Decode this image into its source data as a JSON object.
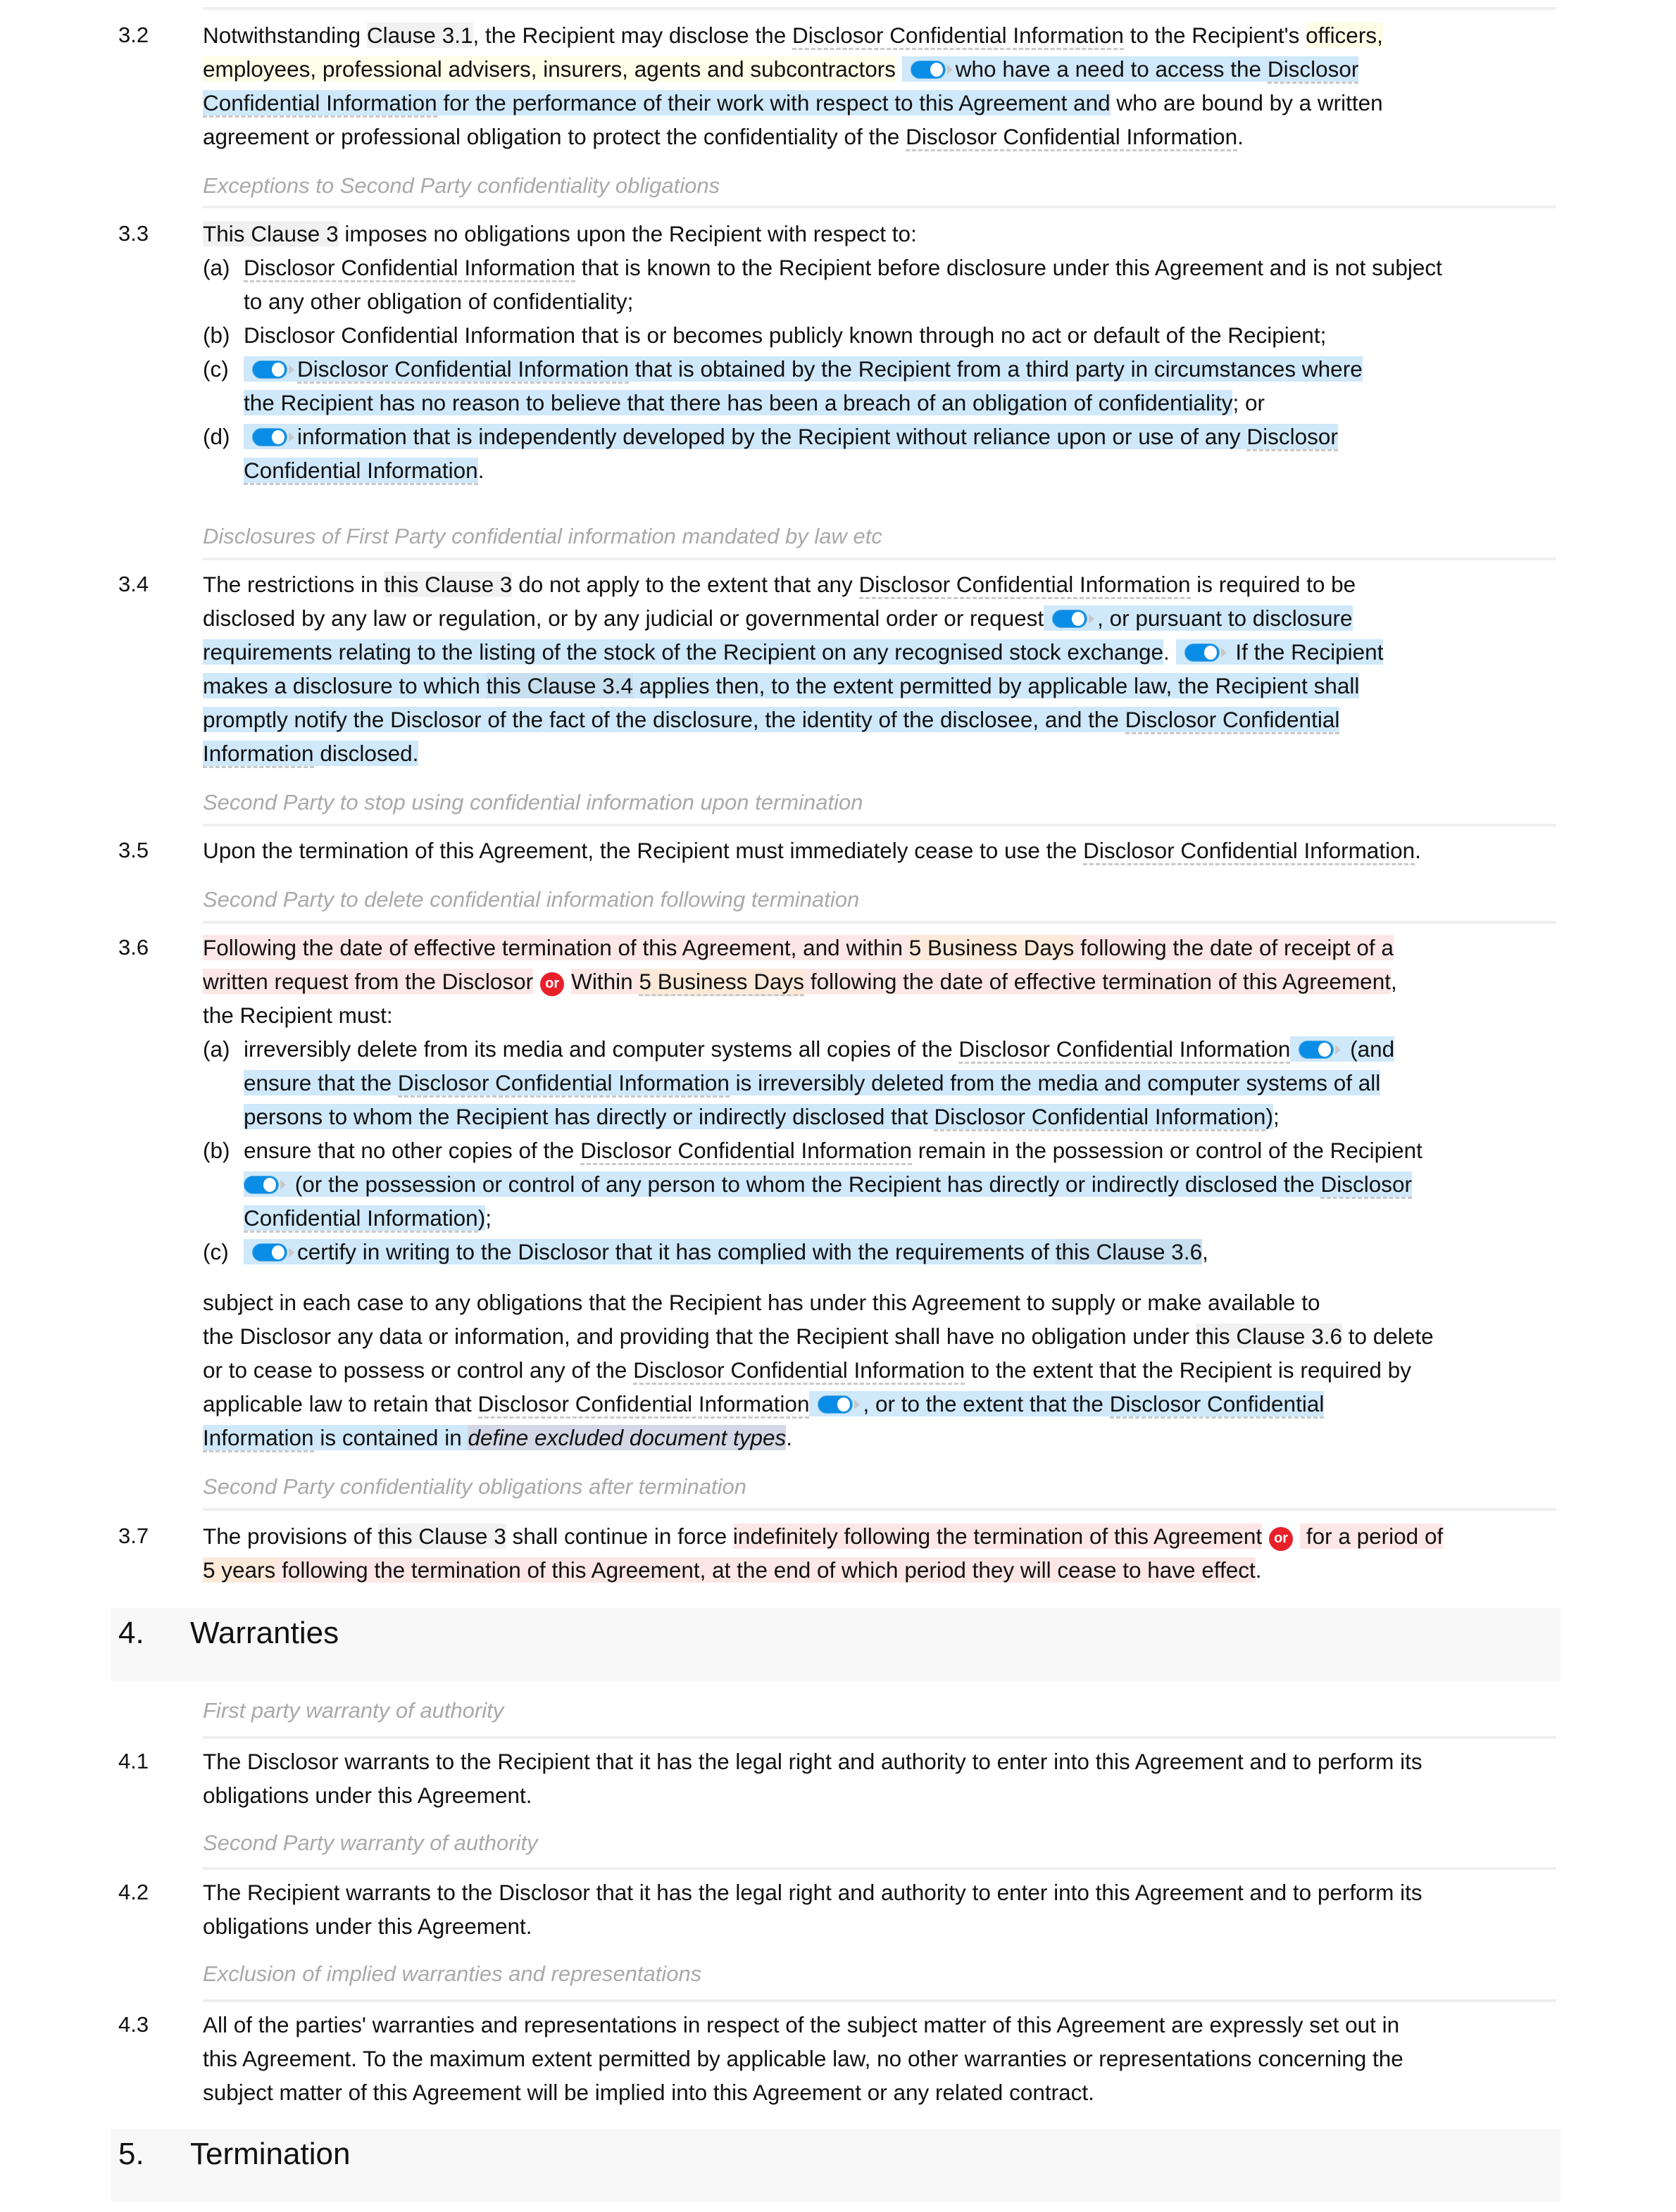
{
  "colors": {
    "toggle_on": "#0a8de6",
    "or_badge": "#e8202a",
    "optional_highlight": "#cfe8fa",
    "alternative_highlight": "#fde6e6",
    "variable_highlight": "#fde9d8",
    "editable_highlight": "#fefee8",
    "caption_text": "#a9a9a9"
  },
  "icons": {
    "toggle": "toggle-switch-on-icon",
    "or": "or-badge-icon"
  },
  "or_label": "or",
  "clause_3_2": {
    "number": "3.2",
    "l1a": "Notwithstanding ",
    "ref_3_1": "Clause 3.1",
    "l1b": ", the Recipient may disclose the ",
    "dci": "Disclosor Confidential Information",
    "l1c": " to the Recipient's ",
    "officers": "officers,",
    "l2a": "employees, professional advisers, insurers, agents and subcontractors",
    "l2b": "who have a need to access the ",
    "l2c": "Disclosor",
    "l3a": "Confidential Information",
    "l3b": " for the performance of their work with respect to this Agreement and",
    "l3c": " who are bound by a written",
    "l4a": "agreement or professional obligation to protect the confidentiality of the ",
    "l4b": "Disclosor Confidential Information",
    "l4c": "."
  },
  "caption_3_3": "Exceptions to Second Party confidentiality obligations",
  "clause_3_3": {
    "number": "3.3",
    "ref": "This Clause 3",
    "intro": " imposes no obligations upon the Recipient with respect to:",
    "a_label": "(a)",
    "a_term": "Disclosor Confidential Information",
    "a_text": " that is known to the Recipient before disclosure under this Agreement and is not subject",
    "a_text2": "to any other obligation of confidentiality;",
    "b_label": "(b)",
    "b_term": "Disclosor Confidential Information",
    "b_text": " that is or becomes publicly known through no act or default of the Recipient;",
    "c_label": "(c)",
    "c_term": "Disclosor Confidential Information",
    "c_text": " that is obtained by the Recipient from a third party in circumstances where",
    "c_text2": "the Recipient has no reason to believe that there has been a breach of an obligation of confidentiality",
    "c_text2_end": "; or",
    "d_label": "(d)",
    "d_text": "information that is independently developed by the Recipient without reliance upon or use of any ",
    "d_term1": "Disclosor",
    "d_term2": "Confidential Information",
    "d_end": "."
  },
  "caption_3_4": "Disclosures of First Party confidential information mandated by law etc",
  "clause_3_4": {
    "number": "3.4",
    "l1a": "The restrictions in ",
    "ref": "this Clause 3",
    "l1b": " do not apply to the extent that any ",
    "l1term": "Disclosor Confidential Information",
    "l1c": " is required to be",
    "l2a": "disclosed by any law or regulation, or by any judicial or governmental order or request",
    "l2b": ", or pursuant to disclosure",
    "l3a": "requirements relating to the listing of the stock of the Recipient on any recognised stock exchange",
    "l3dot": ".",
    "l3b": " If the Recipient",
    "l4a": "makes a disclosure to which ",
    "l4ref": "this Clause 3.4",
    "l4b": " applies then, to the extent permitted by applicable law, the Recipient shall",
    "l5a": "promptly notify the Disclosor of the fact of the disclosure, the identity of the disclosee, and the ",
    "l5term": "Disclosor Confidential",
    "l6term": "Information",
    "l6b": " disclosed."
  },
  "caption_3_5": "Second Party to stop using confidential information upon termination",
  "clause_3_5": {
    "number": "3.5",
    "text": "Upon the termination of this Agreement, the Recipient must immediately cease to use the ",
    "term": "Disclosor Confidential Information",
    "end": "."
  },
  "caption_3_6": "Second Party to delete confidential information following termination",
  "clause_3_6": {
    "number": "3.6",
    "l1a": "Following the date of effective termination of this Agreement, and within ",
    "days1": "5 Business Days",
    "l1b": " following the date of receipt of a",
    "l2a": "written request from the Disclosor",
    "l2b": "Within ",
    "days2": "5 Business Days",
    "l2c": " following the date of effective termination of this Agreement",
    "l2d": ",",
    "l3": "the Recipient must:",
    "a_label": "(a)",
    "a1": "irreversibly delete from its media and computer systems all copies of the ",
    "a1term": "Disclosor Confidential Information",
    "a1b": " (and",
    "a2a": "ensure that the ",
    "a2term": "Disclosor Confidential Information",
    "a2b": " is irreversibly deleted from the media and computer systems of all",
    "a3a": "persons to whom the Recipient has directly or indirectly disclosed that ",
    "a3term": "Disclosor Confidential Information",
    "a3b": ")",
    "a3end": ";",
    "b_label": "(b)",
    "b1a": "ensure that no other copies of the ",
    "b1term": "Disclosor Confidential Information",
    "b1b": " remain in the possession or control of the Recipient",
    "b2a": " (or the possession or control of any person to whom the Recipient has directly or indirectly disclosed the ",
    "b2term": "Disclosor",
    "b3term": "Confidential Information",
    "b3b": ")",
    "b3end": ";",
    "c_label": "(c)",
    "c1a": "certify in writing to the Disclosor that it has complied with the requirements of ",
    "c1ref": "this Clause 3.6",
    "c1end": ",",
    "s1": "subject in each case to any obligations that the Recipient has under this Agreement to supply or make available to",
    "s2a": "the Disclosor any data or information, and providing that the Recipient shall have no obligation under ",
    "s2ref": "this Clause 3.6",
    "s2b": " to delete",
    "s3a": "or to cease to possess or control any of the ",
    "s3term": "Disclosor Confidential Information",
    "s3b": " to the extent that the Recipient is required by",
    "s4a": "applicable law to retain that ",
    "s4term": "Disclosor Confidential Information",
    "s4b": ", or to the extent that the ",
    "s4term2": "Disclosor Confidential",
    "s5term": "Information",
    "s5b": " is contained in ",
    "s5placeholder": "define excluded document types",
    "s5end": "."
  },
  "caption_3_7": "Second Party confidentiality obligations after termination",
  "clause_3_7": {
    "number": "3.7",
    "l1a": "The provisions of ",
    "ref": "this Clause 3",
    "l1b": " shall continue in force ",
    "alt1": "indefinitely following the termination of this Agreement",
    "alt2": " for a period of",
    "years": "5 years",
    "l2b": " following the termination of this Agreement, at the end of which period they will cease to have effect",
    "l2end": "."
  },
  "section_4": {
    "number": "4.",
    "title": "Warranties"
  },
  "caption_4_1": "First party warranty of authority",
  "clause_4_1": {
    "number": "4.1",
    "l1": "The Disclosor warrants to the Recipient that it has the legal right and authority to enter into this Agreement and to perform its",
    "l2": "obligations under this Agreement."
  },
  "caption_4_2": "Second Party warranty of authority",
  "clause_4_2": {
    "number": "4.2",
    "l1": "The Recipient warrants to the Disclosor that it has the legal right and authority to enter into this Agreement and to perform its",
    "l2": "obligations under this Agreement."
  },
  "caption_4_3": "Exclusion of implied warranties and representations",
  "clause_4_3": {
    "number": "4.3",
    "l1": "All of the parties' warranties and representations in respect of the subject matter of this Agreement are expressly set out in",
    "l2": "this Agreement. To the maximum extent permitted by applicable law, no other warranties or representations concerning the",
    "l3": "subject matter of this Agreement will be implied into this Agreement or any related contract."
  },
  "section_5": {
    "number": "5.",
    "title": "Termination"
  }
}
